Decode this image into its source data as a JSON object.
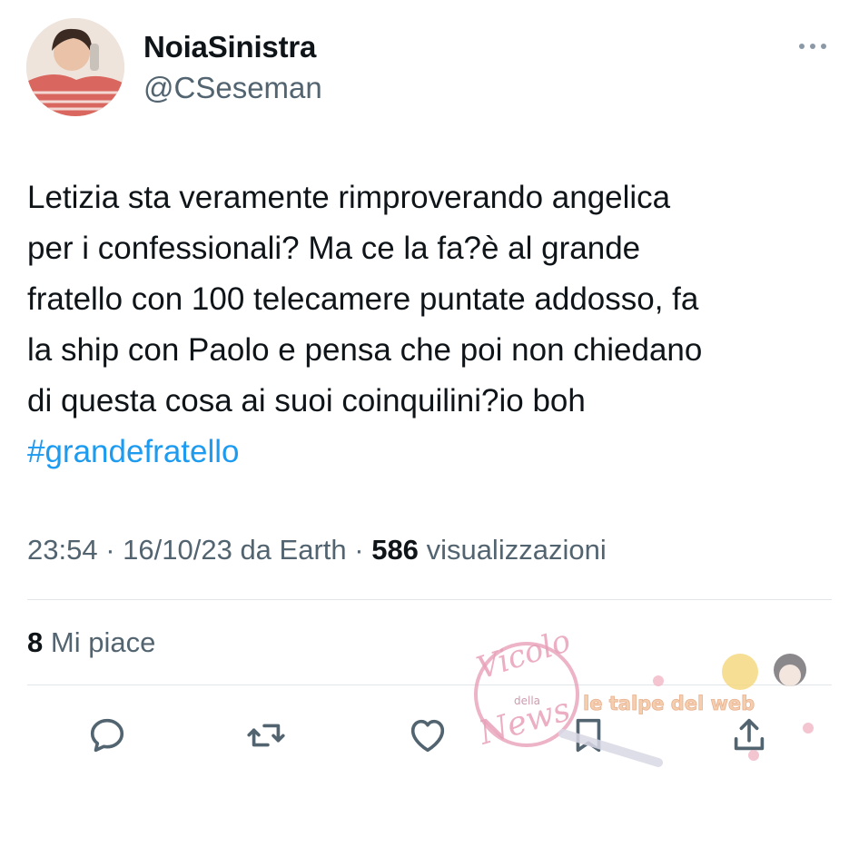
{
  "author": {
    "display_name": "NoiaSinistra",
    "handle": "@CSeseman"
  },
  "tweet": {
    "lines": [
      "Letizia sta veramente rimproverando angelica",
      "per i confessionali? Ma ce la fa?è al grande",
      "fratello con 100 telecamere puntate addosso, fa",
      "la ship con Paolo e pensa che poi non chiedano",
      "di questa cosa ai suoi coinquilini?io boh"
    ],
    "hashtag": "#grandefratello"
  },
  "meta": {
    "time": "23:54",
    "date": "16/10/23",
    "source": "da Earth",
    "views_count": "586",
    "views_label": "visualizzazioni"
  },
  "likes": {
    "count": "8",
    "label": "Mi piace"
  },
  "actions": [
    {
      "icon": "reply-icon"
    },
    {
      "icon": "retweet-icon"
    },
    {
      "icon": "like-icon"
    },
    {
      "icon": "bookmark-icon"
    },
    {
      "icon": "share-icon"
    }
  ],
  "watermark": {
    "logo_text": [
      "Vicolo",
      "della",
      "News"
    ],
    "banner_text": "le talpe del web"
  },
  "colors": {
    "text": "#0f1419",
    "secondary": "#536471",
    "link": "#1d9bf0",
    "divider": "#e1e6ea",
    "watermark_pink": "#e8a0b8"
  }
}
